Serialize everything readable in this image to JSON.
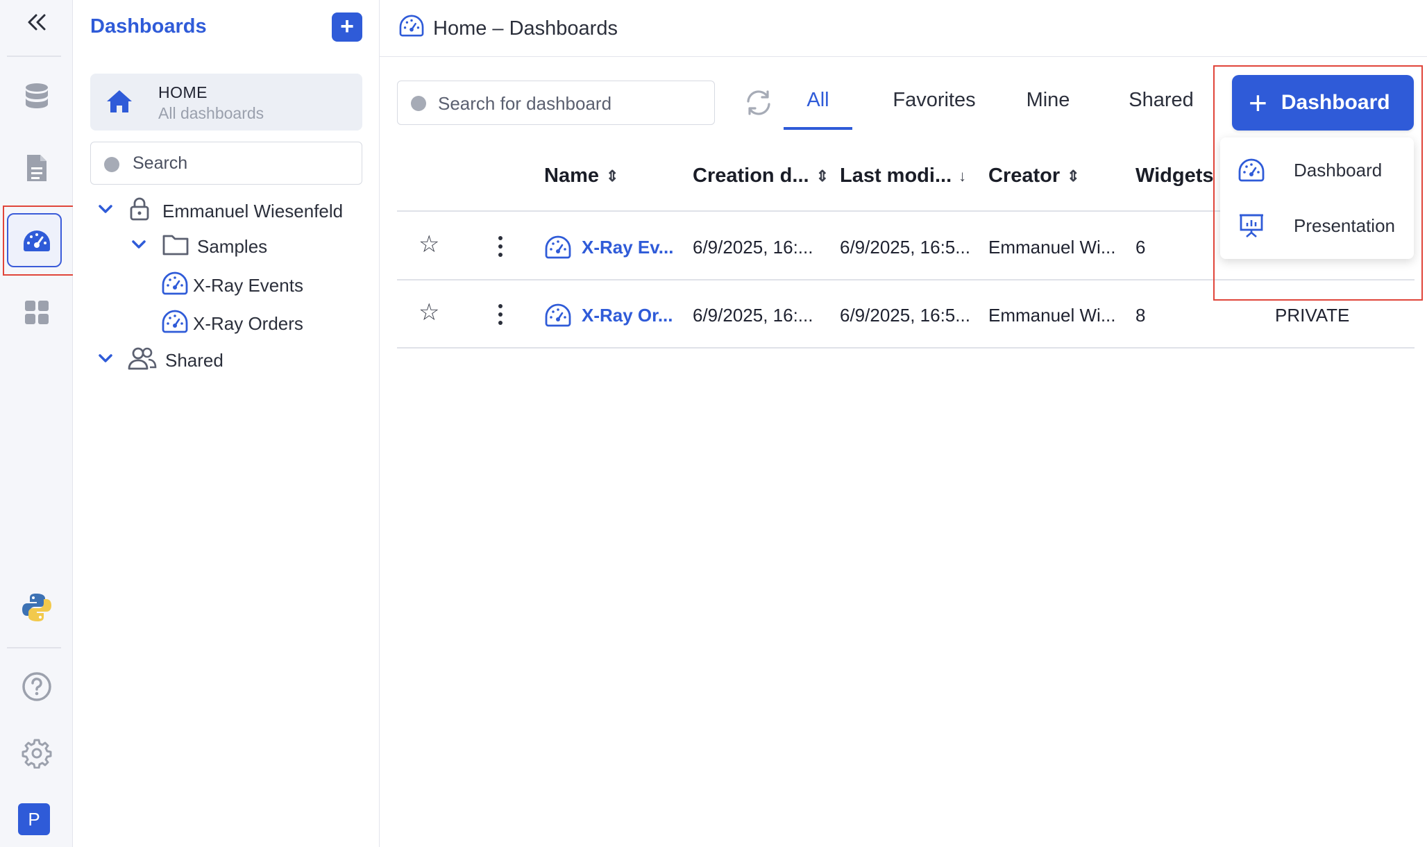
{
  "rail": {
    "collapse_icon": "double-chevron-left-icon",
    "items": [
      "database-icon",
      "document-icon",
      "dashboard-gauge-icon",
      "grid-apps-icon",
      "python-icon",
      "help-icon",
      "gear-icon"
    ],
    "avatar_letter": "P"
  },
  "sidebar": {
    "title": "Dashboards",
    "add_label": "+",
    "home": {
      "title": "HOME",
      "subtitle": "All dashboards"
    },
    "search_placeholder": "Search",
    "tree": {
      "user": "Emmanuel Wiesenfeld",
      "folder": "Samples",
      "items": [
        "X-Ray Events",
        "X-Ray Orders"
      ],
      "shared": "Shared"
    }
  },
  "header": {
    "breadcrumb": "Home – Dashboards"
  },
  "toolbar": {
    "search_placeholder": "Search for dashboard",
    "tabs": [
      "All",
      "Favorites",
      "Mine",
      "Shared"
    ],
    "active_tab": "All",
    "new_button": "Dashboard"
  },
  "dropdown": {
    "items": [
      {
        "label": "Dashboard",
        "icon": "dashboard-gauge-icon"
      },
      {
        "label": "Presentation",
        "icon": "presentation-icon"
      }
    ]
  },
  "table": {
    "columns": [
      "Name",
      "Creation d...",
      "Last modi...",
      "Creator",
      "Widgets"
    ],
    "rows": [
      {
        "name": "X-Ray Ev...",
        "created": "6/9/2025, 16:...",
        "modified": "6/9/2025, 16:5...",
        "creator": "Emmanuel Wi...",
        "widgets": "6",
        "visibility": ""
      },
      {
        "name": "X-Ray Or...",
        "created": "6/9/2025, 16:...",
        "modified": "6/9/2025, 16:5...",
        "creator": "Emmanuel Wi...",
        "widgets": "8",
        "visibility": "PRIVATE"
      }
    ]
  },
  "colors": {
    "accent": "#2f5bd8",
    "highlight": "#e0453a"
  }
}
